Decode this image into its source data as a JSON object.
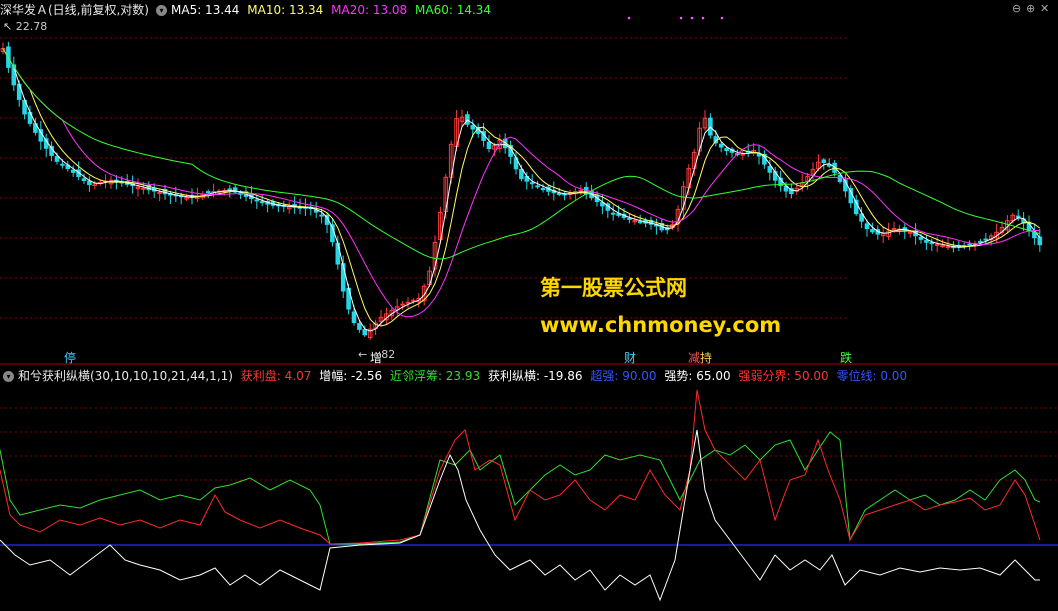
{
  "top_header": {
    "title": "深华发Ａ(日线,前复权,对数)",
    "ma5": "MA5: 13.44",
    "ma10": "MA10: 13.34",
    "ma20": "MA20: 13.08",
    "ma60": "MA60: 14.34"
  },
  "indicator_header": {
    "title": "和兮获利纵横(30,10,10,10,21,44,1,1)",
    "items": [
      {
        "text": "获利盘: 4.07",
        "color": "#ff3333"
      },
      {
        "text": "增幅: -2.56",
        "color": "#ffffff"
      },
      {
        "text": "近邻浮筹: 23.93",
        "color": "#33dd33"
      },
      {
        "text": "获利纵横: -19.86",
        "color": "#ffffff"
      },
      {
        "text": "超强: 90.00",
        "color": "#3355ff"
      },
      {
        "text": "强势: 65.00",
        "color": "#ffffff"
      },
      {
        "text": "强弱分界: 50.00",
        "color": "#ff3333"
      },
      {
        "text": "零位线: 0.00",
        "color": "#3355ff"
      }
    ]
  },
  "labels": {
    "high": "22.78",
    "low": "82"
  },
  "events": [
    {
      "text": "停",
      "color": "#44ccff"
    },
    {
      "text": "增",
      "color": "#ffffff"
    },
    {
      "text": "财",
      "color": "#44ccff"
    },
    {
      "text": "减",
      "color": "#ff5555"
    },
    {
      "text": "持",
      "color": "#ffcc55"
    },
    {
      "text": "跌",
      "color": "#44ff44"
    }
  ],
  "watermark": {
    "line1": "第一股票公式网",
    "line2": "www.chnmoney.com"
  },
  "colors": {
    "up": "#ff3b3b",
    "down": "#25d7e6",
    "ma5": "#ffffff",
    "ma10": "#ffff66",
    "ma20": "#ff33ff",
    "ma60": "#33ff33",
    "ind_red": "#ff2a2a",
    "ind_green": "#33dd33",
    "ind_white": "#ffffff",
    "zero_line": "#2a2aff",
    "grid": "#8b0000"
  },
  "chart_data": [
    {
      "type": "candlestick",
      "scale": "log",
      "series": [
        {
          "name": "MA5",
          "values": [
            13.44
          ]
        },
        {
          "name": "MA10",
          "values": [
            13.34
          ]
        },
        {
          "name": "MA20",
          "values": [
            13.08
          ]
        },
        {
          "name": "MA60",
          "values": [
            14.34
          ]
        }
      ],
      "ylim": [
        10.8,
        22.78
      ]
    },
    {
      "type": "line",
      "series": [
        {
          "name": "获利盘",
          "values": [
            4.07
          ]
        },
        {
          "name": "近邻浮筹",
          "values": [
            23.93
          ]
        },
        {
          "name": "获利纵横",
          "values": [
            -19.86
          ]
        }
      ],
      "reference_lines": [
        {
          "name": "超强",
          "value": 90.0
        },
        {
          "name": "强势",
          "value": 65.0
        },
        {
          "name": "强弱分界",
          "value": 50.0
        },
        {
          "name": "零位线",
          "value": 0.0
        }
      ]
    }
  ]
}
